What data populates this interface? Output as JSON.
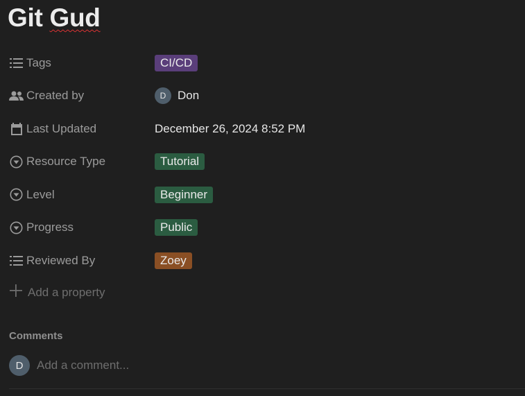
{
  "page": {
    "title_part1": "Git ",
    "title_part2": "Gud"
  },
  "properties": [
    {
      "label": "Tags",
      "icon": "list-icon",
      "value": "CI/CD",
      "kind": "tag",
      "color": "#5a3e7a"
    },
    {
      "label": "Created by",
      "icon": "people-icon",
      "value": "Don",
      "kind": "person",
      "avatar_letter": "D"
    },
    {
      "label": "Last Updated",
      "icon": "calendar-icon",
      "value": "December 26, 2024 8:52 PM",
      "kind": "text"
    },
    {
      "label": "Resource Type",
      "icon": "select-icon",
      "value": "Tutorial",
      "kind": "tag",
      "color": "#2b5c41"
    },
    {
      "label": "Level",
      "icon": "select-icon",
      "value": "Beginner",
      "kind": "tag",
      "color": "#2b5c41"
    },
    {
      "label": "Progress",
      "icon": "select-icon",
      "value": "Public",
      "kind": "tag",
      "color": "#2b5c41"
    },
    {
      "label": "Reviewed By",
      "icon": "list-icon",
      "value": "Zoey",
      "kind": "tag",
      "color": "#8a4f24"
    }
  ],
  "add_property": {
    "label": "Add a property",
    "icon": "plus-icon"
  },
  "comments": {
    "heading": "Comments",
    "avatar_letter": "D",
    "placeholder": "Add a comment..."
  }
}
